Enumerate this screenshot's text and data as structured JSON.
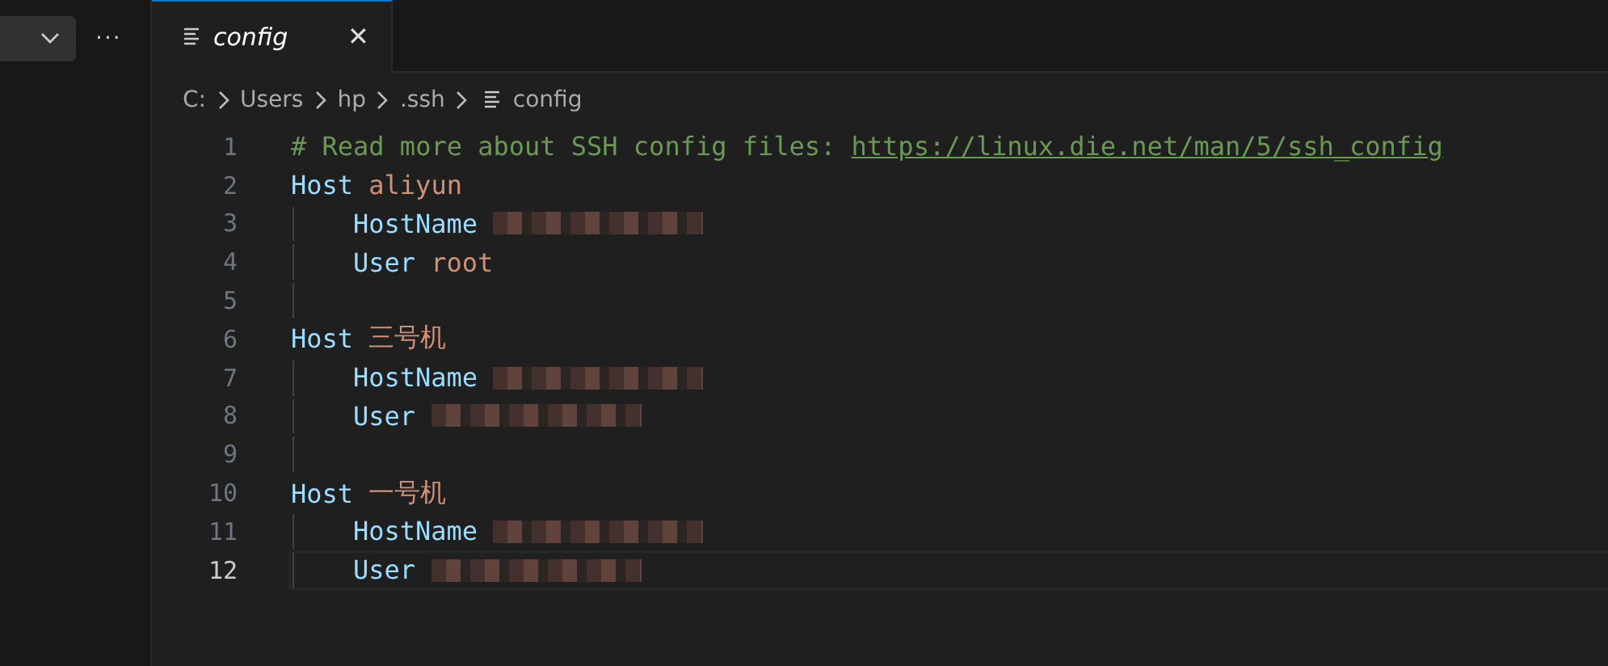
{
  "sidebar": {
    "dropdown": {
      "expanded": false
    },
    "more_button": "···"
  },
  "tabs": [
    {
      "label": "config",
      "selected": true,
      "close": "✕"
    }
  ],
  "breadcrumbs": [
    "C:",
    "Users",
    "hp",
    ".ssh",
    "config"
  ],
  "lines": [
    {
      "number": "1",
      "indented": false,
      "selected": false,
      "tokens": [
        {
          "kind": "comment",
          "text": "# Read more about SSH config files: "
        },
        {
          "kind": "link",
          "text": "https://linux.die.net/man/5/ssh_config"
        }
      ]
    },
    {
      "number": "2",
      "indented": false,
      "selected": false,
      "tokens": [
        {
          "kind": "key",
          "text": "Host"
        },
        {
          "kind": "value",
          "text": "aliyun"
        }
      ]
    },
    {
      "number": "3",
      "indented": true,
      "selected": false,
      "tokens": [
        {
          "kind": "key",
          "text": "HostName"
        },
        {
          "kind": "redacted"
        }
      ]
    },
    {
      "number": "4",
      "indented": true,
      "selected": false,
      "tokens": [
        {
          "kind": "key",
          "text": "User"
        },
        {
          "kind": "value",
          "text": "root"
        }
      ]
    },
    {
      "number": "5",
      "indented": true,
      "selected": false
    },
    {
      "number": "6",
      "indented": false,
      "selected": false,
      "tokens": [
        {
          "kind": "key",
          "text": "Host"
        },
        {
          "kind": "value",
          "text": "三号机"
        }
      ]
    },
    {
      "number": "7",
      "indented": true,
      "selected": false,
      "tokens": [
        {
          "kind": "key",
          "text": "HostName"
        },
        {
          "kind": "redacted"
        }
      ]
    },
    {
      "number": "8",
      "indented": true,
      "selected": false,
      "tokens": [
        {
          "kind": "key",
          "text": "User"
        },
        {
          "kind": "redacted"
        }
      ]
    },
    {
      "number": "9",
      "indented": true,
      "selected": false
    },
    {
      "number": "10",
      "indented": false,
      "selected": false,
      "tokens": [
        {
          "kind": "key",
          "text": "Host"
        },
        {
          "kind": "value",
          "text": "一号机"
        }
      ]
    },
    {
      "number": "11",
      "indented": true,
      "selected": false,
      "tokens": [
        {
          "kind": "key",
          "text": "HostName"
        },
        {
          "kind": "redacted"
        }
      ]
    },
    {
      "number": "12",
      "indented": true,
      "selected": true,
      "tokens": [
        {
          "kind": "key",
          "text": "User"
        },
        {
          "kind": "redacted"
        }
      ]
    }
  ]
}
